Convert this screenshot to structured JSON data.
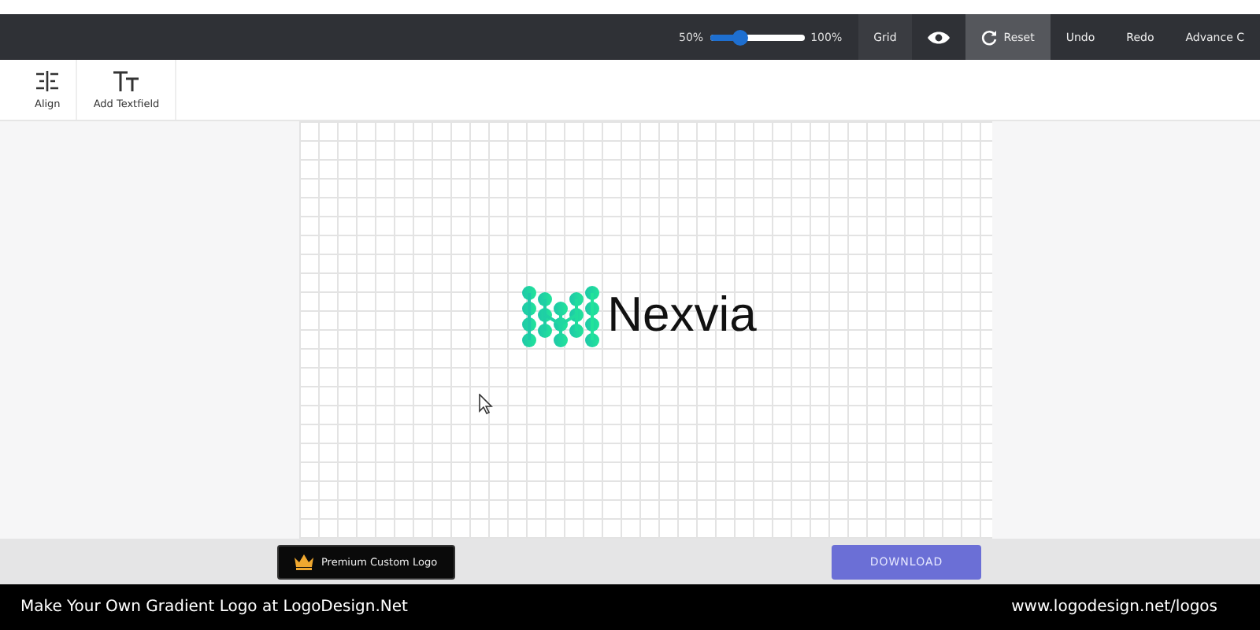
{
  "topbar": {
    "zoom": {
      "min_label": "50%",
      "max_label": "100%",
      "level": 0.33
    },
    "items": [
      {
        "kind": "text",
        "label": "Grid",
        "selected": false
      },
      {
        "kind": "eye",
        "selected": false
      },
      {
        "kind": "reset",
        "label": "Reset",
        "selected": true
      },
      {
        "kind": "text",
        "label": "Undo",
        "selected": false
      },
      {
        "kind": "text",
        "label": "Redo",
        "selected": false
      },
      {
        "kind": "text",
        "label": "Advance C",
        "selected": false
      }
    ]
  },
  "toolbar": {
    "tools": [
      {
        "kind": "align",
        "label": "Align"
      },
      {
        "kind": "text",
        "label": "Add Textfield"
      }
    ]
  },
  "canvas": {
    "logo_text": "Nexvia"
  },
  "actions": {
    "premium": "Premium Custom Logo",
    "download": "DOWNLOAD"
  },
  "footer": {
    "left": "Make Your Own Gradient Logo at LogoDesign.Net",
    "right": "www.logodesign.net/logos"
  }
}
